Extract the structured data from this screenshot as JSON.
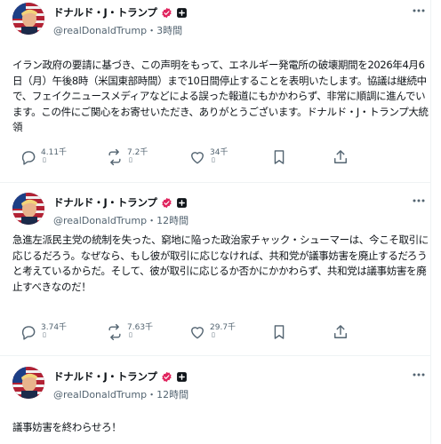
{
  "posts": [
    {
      "author_name": "ドナルド・J・トランプ",
      "handle": "@realDonaldTrump",
      "separator": "・",
      "time": "3時間",
      "text": "イラン政府の要請に基づき、この声明をもって、エネルギー発電所の破壊期間を2026年4月6日（月）午後8時（米国東部時間）まで10日間停止することを表明いたします。協議は継続中で、フェイクニュースメディアなどによる誤った報道にもかかわらず、非常に順調に進んでいます。この件にご関心をお寄せいただき、ありがとうございます。ドナルド・J・トランプ大統領",
      "stats": {
        "replies": "4.11千",
        "reposts": "7.2千",
        "likes": "34千"
      },
      "placeholder_glyph": "▯"
    },
    {
      "author_name": "ドナルド・J・トランプ",
      "handle": "@realDonaldTrump",
      "separator": "・",
      "time": "12時間",
      "text": "急進左派民主党の統制を失った、窮地に陥った政治家チャック・シューマーは、今こそ取引に応じるだろう。なぜなら、もし彼が取引に応じなければ、共和党が議事妨害を廃止するだろうと考えているからだ。そして、彼が取引に応じるか否かにかかわらず、共和党は議事妨害を廃止すべきなのだ！",
      "stats": {
        "replies": "3.74千",
        "reposts": "7.63千",
        "likes": "29.7千"
      },
      "placeholder_glyph": "▯"
    },
    {
      "author_name": "ドナルド・J・トランプ",
      "handle": "@realDonaldTrump",
      "separator": "・",
      "time": "12時間",
      "text": "議事妨害を終わらせろ！"
    }
  ],
  "icons": {
    "verified": "verified-badge-icon",
    "affiliate": "plus-affiliate-icon",
    "reply": "reply-icon",
    "repost": "repost-icon",
    "like": "heart-icon",
    "bookmark": "bookmark-icon",
    "share": "share-icon",
    "more": "more-icon"
  },
  "colors": {
    "verified": "#e0245e",
    "text": "#0f1419",
    "muted": "#536471",
    "divider": "#eff3f4"
  }
}
